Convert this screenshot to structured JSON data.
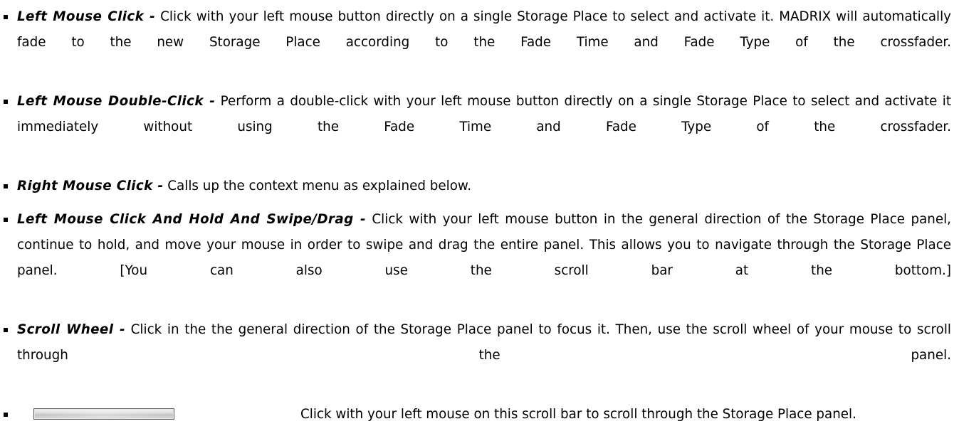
{
  "items": [
    {
      "term": "Left Mouse Click -",
      "text": " Click with your left mouse button directly on a single Storage Place to select and activate it. MADRIX will automatically fade to the new Storage Place according to the Fade Time and Fade Type of the crossfader."
    },
    {
      "term": "Left Mouse Double-Click -",
      "text": " Perform a double-click with your left mouse button directly on a single Storage Place to select and activate it immediately without using the Fade Time and Fade Type of the crossfader."
    },
    {
      "term": "Right Mouse Click -",
      "text": " Calls up the context menu as explained below."
    },
    {
      "term": "Left Mouse Click And Hold And Swipe/Drag -",
      "text": " Click with your left mouse button in the general direction of the Storage Place panel, continue to hold, and move your mouse in order to swipe and drag the entire panel. This allows you to navigate through the Storage Place panel. [You can also use the scroll bar at the bottom.]"
    },
    {
      "term": "Scroll Wheel -",
      "text": " Click in the the general direction of the Storage Place panel to focus it. Then, use the scroll wheel of your mouse to scroll through the panel."
    }
  ],
  "scrollbar_item": {
    "icon": "scroll-bar-icon",
    "text": "Click with your left mouse on this scroll bar to scroll through the Storage Place panel."
  }
}
